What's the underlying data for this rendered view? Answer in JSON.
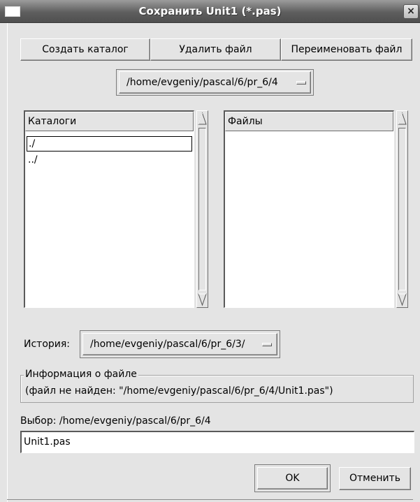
{
  "window": {
    "title": "Сохранить Unit1 (*.pas)",
    "close_glyph": "×"
  },
  "toolbar": {
    "create_dir": "Создать каталог",
    "delete_file": "Удалить файл",
    "rename_file": "Переименовать файл"
  },
  "path_selector": {
    "value": "/home/evgeniy/pascal/6/pr_6/4"
  },
  "directories": {
    "header": "Каталоги",
    "items": [
      "./",
      "../"
    ]
  },
  "files": {
    "header": "Файлы",
    "items": []
  },
  "history": {
    "label": "История:",
    "value": "/home/evgeniy/pascal/6/pr_6/3/"
  },
  "file_info": {
    "legend": "Информация о файле",
    "text": "(файл не найден: \"/home/evgeniy/pascal/6/pr_6/4/Unit1.pas\")"
  },
  "selection": {
    "label": "Выбор: /home/evgeniy/pascal/6/pr_6/4",
    "filename": "Unit1.pas"
  },
  "actions": {
    "ok": "OK",
    "cancel": "Отменить"
  },
  "icons": {
    "window": "window-icon",
    "close": "close-icon",
    "scroll_up": "arrow-up-icon",
    "scroll_down": "arrow-down-icon"
  }
}
